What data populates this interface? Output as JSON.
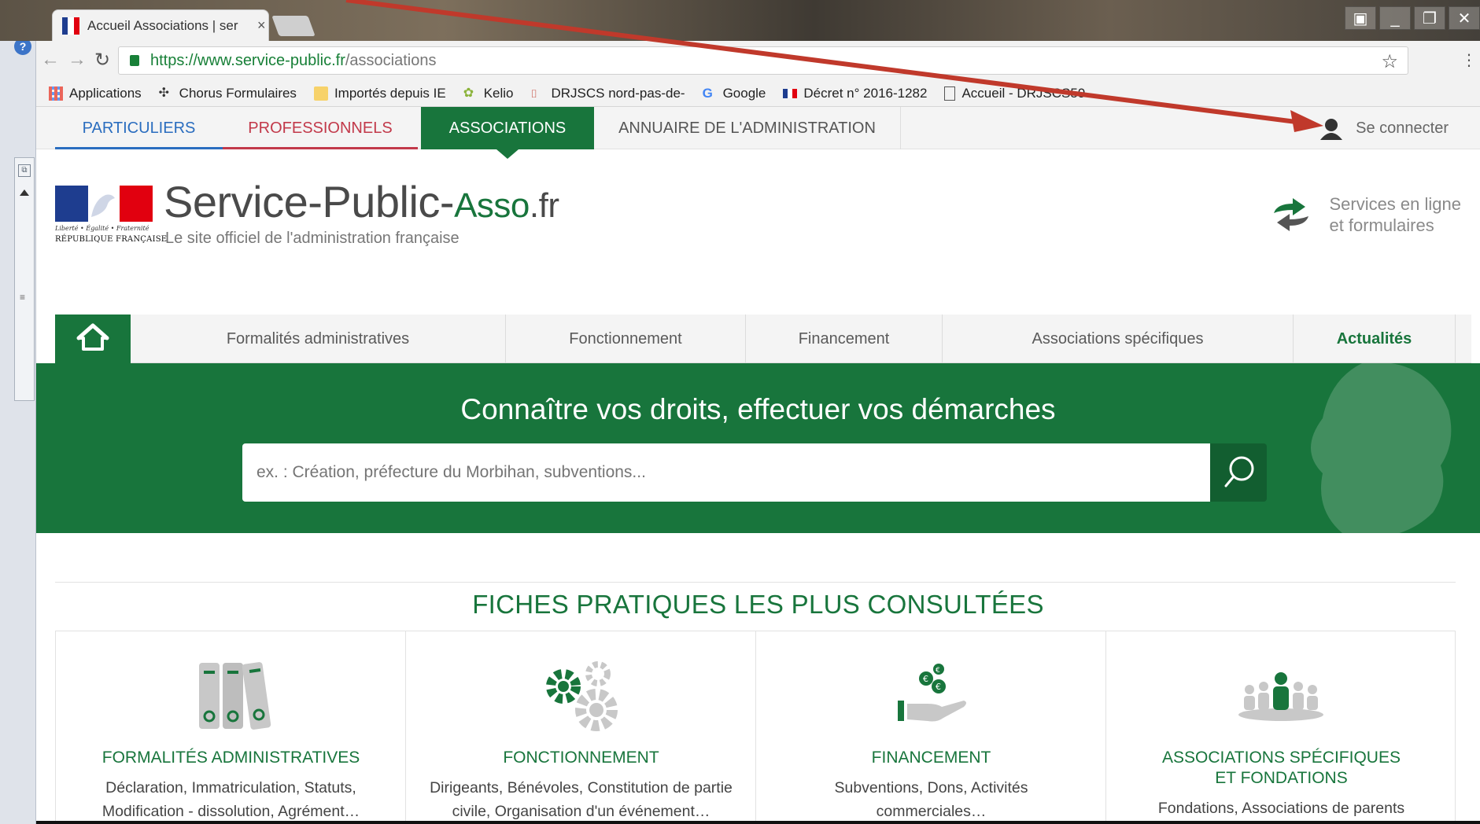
{
  "browser": {
    "tab_title": "Accueil Associations | ser",
    "tab_close": "×",
    "url_host": "https://www.service-public.fr",
    "url_path": "/associations",
    "bookmarks": [
      "Applications",
      "Chorus Formulaires",
      "Importés depuis IE",
      "Kelio",
      "DRJSCS nord-pas-de-",
      "Google",
      "Décret n° 2016-1282",
      "Accueil - DRJSCS59"
    ]
  },
  "topnav": {
    "particuliers": "PARTICULIERS",
    "professionnels": "PROFESSIONNELS",
    "associations": "ASSOCIATIONS",
    "annuaire": "ANNUAIRE DE L'ADMINISTRATION",
    "login": "Se connecter"
  },
  "header": {
    "devise": "Liberté • Égalité • Fraternité",
    "republique": "RÉPUBLIQUE FRANÇAISE",
    "brand_main": "Service-Public-",
    "brand_asso": "Asso",
    "brand_fr": ".fr",
    "tagline": "Le site officiel de l'administration française",
    "services_line1": "Services en ligne",
    "services_line2": "et formulaires"
  },
  "mainnav": {
    "items": [
      "Formalités administratives",
      "Fonctionnement",
      "Financement",
      "Associations spécifiques",
      "Actualités"
    ]
  },
  "hero": {
    "title": "Connaître vos droits, effectuer vos démarches",
    "search_placeholder": "ex. : Création, préfecture du Morbihan, subventions..."
  },
  "fiches": {
    "title": "FICHES PRATIQUES LES PLUS CONSULTÉES",
    "cards": [
      {
        "title": "FORMALITÉS ADMINISTRATIVES",
        "desc1": "Déclaration, Immatriculation, Statuts,",
        "desc2": "Modification - dissolution, Agrément…",
        "icon": "binders-icon"
      },
      {
        "title": "FONCTIONNEMENT",
        "desc1": "Dirigeants, Bénévoles, Constitution de partie",
        "desc2": "civile, Organisation d'un événement…",
        "icon": "gears-icon"
      },
      {
        "title": "FINANCEMENT",
        "desc1": "Subventions, Dons, Activités",
        "desc2": "commerciales…",
        "icon": "euro-hand-icon"
      },
      {
        "title": "ASSOCIATIONS SPÉCIFIQUES",
        "title2": "ET FONDATIONS",
        "desc1": "Fondations, Associations de parents",
        "icon": "group-icon"
      }
    ]
  },
  "colors": {
    "green": "#18753c",
    "blue": "#2a6dbf",
    "red": "#c2394a",
    "annotation_arrow": "#c0392b"
  }
}
